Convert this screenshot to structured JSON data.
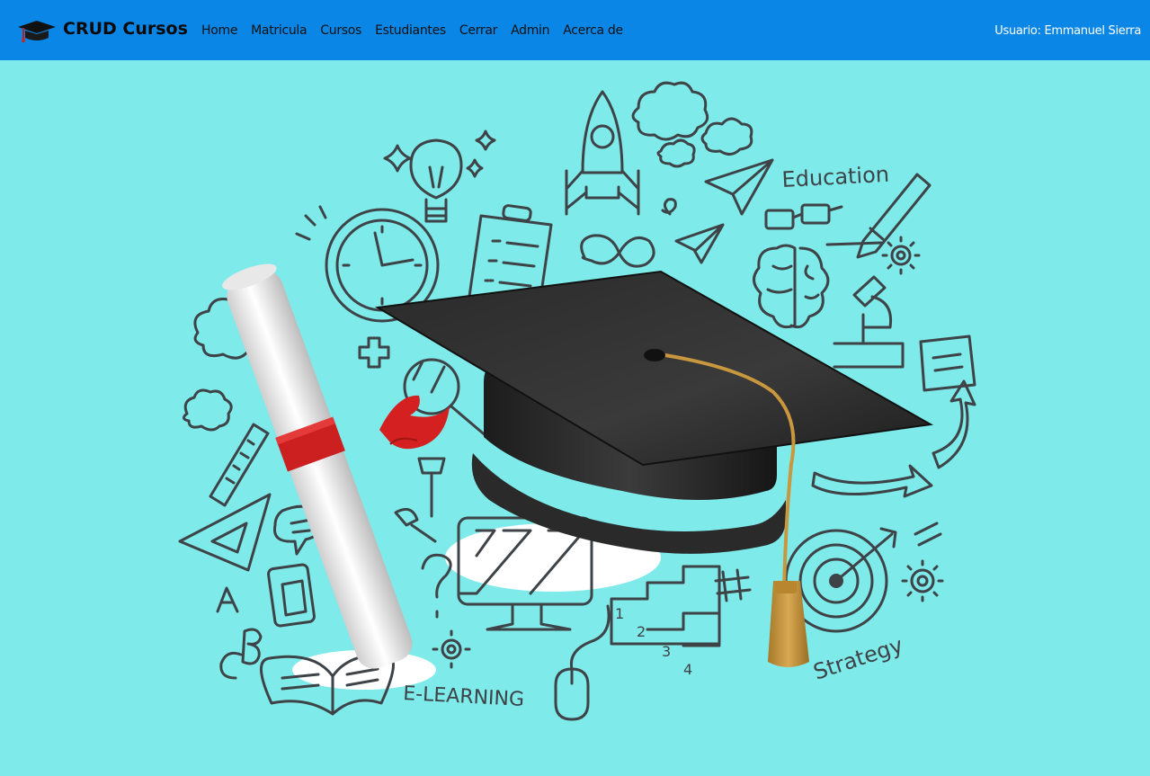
{
  "navbar": {
    "brand": "CRUD Cursos",
    "links": [
      "Home",
      "Matricula",
      "Cursos",
      "Estudiantes",
      "Cerrar",
      "Admin",
      "Acerca de"
    ],
    "user_label": "Usuario: Emmanuel Sierra",
    "background": "#0a86e6"
  },
  "hero": {
    "background": "#7eeaea",
    "words": {
      "education": "Education",
      "elearning": "E-LEARNING",
      "strategy": "Strategy"
    },
    "icons": [
      "graduation-cap-icon",
      "diploma-scroll-icon",
      "rocket-icon",
      "clock-icon",
      "lightbulb-icon",
      "target-icon",
      "brain-icon",
      "microscope-icon"
    ]
  }
}
